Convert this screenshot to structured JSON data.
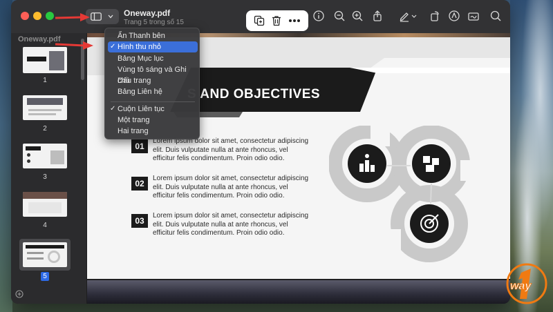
{
  "window": {
    "doc_title": "Oneway.pdf",
    "doc_subtitle": "Trang 5 trong số 15"
  },
  "toolbar_icons": [
    "sidebar-icon",
    "chevron-down-icon",
    "info-icon",
    "zoom-out-icon",
    "zoom-in-icon",
    "share-icon",
    "pen-icon",
    "rotate-icon",
    "markup-icon",
    "signature-icon",
    "search-icon"
  ],
  "float_toolbar_icons": [
    "duplicate-icon",
    "trash-icon",
    "more-icon"
  ],
  "sidebar": {
    "filename": "Oneway.pdf",
    "thumbnails": [
      {
        "label": "1"
      },
      {
        "label": "2"
      },
      {
        "label": "3"
      },
      {
        "label": "4"
      },
      {
        "label": "5",
        "selected": true
      }
    ]
  },
  "view_menu": {
    "items": [
      {
        "label": "Ẩn Thanh bên",
        "checked": false
      },
      {
        "label": "Hình thu nhỏ",
        "checked": true,
        "highlighted": true
      },
      {
        "label": "Bảng Mục lục",
        "checked": false
      },
      {
        "label": "Vùng tô sáng và Ghi chú",
        "checked": false
      },
      {
        "label": "Dấu trang",
        "checked": false
      },
      {
        "label": "Bảng Liên hệ",
        "checked": false
      },
      {
        "label": "Cuộn Liên tục",
        "checked": true
      },
      {
        "label": "Một trang",
        "checked": false
      },
      {
        "label": "Hai trang",
        "checked": false
      }
    ]
  },
  "page": {
    "heading": "S AND OBJECTIVES",
    "items": [
      {
        "num": "01",
        "text": "Lorem ipsum dolor sit amet, consectetur adipiscing elit. Duis vulputate nulla at ante rhoncus, vel efficitur felis condimentum. Proin odio odio."
      },
      {
        "num": "02",
        "text": "Lorem ipsum dolor sit amet, consectetur adipiscing elit. Duis vulputate nulla at ante rhoncus, vel efficitur felis condimentum. Proin odio odio."
      },
      {
        "num": "03",
        "text": "Lorem ipsum dolor sit amet, consectetur adipiscing elit. Duis vulputate nulla at ante rhoncus, vel efficitur felis condimentum. Proin odio odio."
      }
    ]
  },
  "colors": {
    "menu_highlight": "#3b6fd9",
    "arrow": "#e53935",
    "logo": "#f07a12"
  }
}
